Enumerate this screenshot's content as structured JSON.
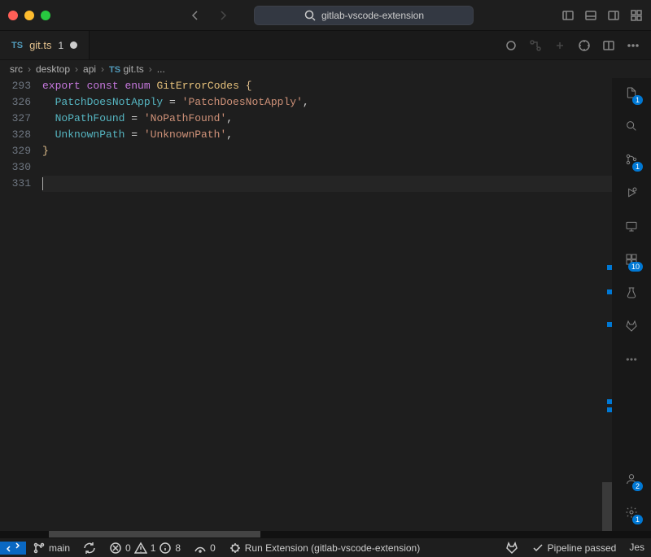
{
  "title": {
    "search_text": "gitlab-vscode-extension"
  },
  "tab": {
    "ts_label": "TS",
    "filename": "git.ts",
    "modified_count": "1"
  },
  "breadcrumb": [
    "src",
    "desktop",
    "api",
    "TS git.ts",
    "..."
  ],
  "line_numbers": [
    "293",
    "326",
    "327",
    "328",
    "329",
    "330",
    "331"
  ],
  "code": {
    "l0": {
      "kw1": "export",
      "kw2": "const",
      "kw3": "enum",
      "type": "GitErrorCodes",
      "brace": "{"
    },
    "l1": {
      "member": "PatchDoesNotApply",
      "eq": " = ",
      "str": "'PatchDoesNotApply'",
      "comma": ","
    },
    "l2": {
      "member": "NoPathFound",
      "eq": " = ",
      "str": "'NoPathFound'",
      "comma": ","
    },
    "l3": {
      "member": "UnknownPath",
      "eq": " = ",
      "str": "'UnknownPath'",
      "comma": ","
    },
    "l4": {
      "brace": "}"
    }
  },
  "activity_badges": {
    "explorer": "1",
    "scm": "1",
    "extensions": "10",
    "account": "2",
    "settings": "1"
  },
  "statusbar": {
    "branch": "main",
    "errors": "0",
    "warnings": "1",
    "info": "8",
    "ports": "0",
    "run": "Run Extension (gitlab-vscode-extension)",
    "pipeline": "Pipeline passed",
    "tail": "Jes"
  }
}
